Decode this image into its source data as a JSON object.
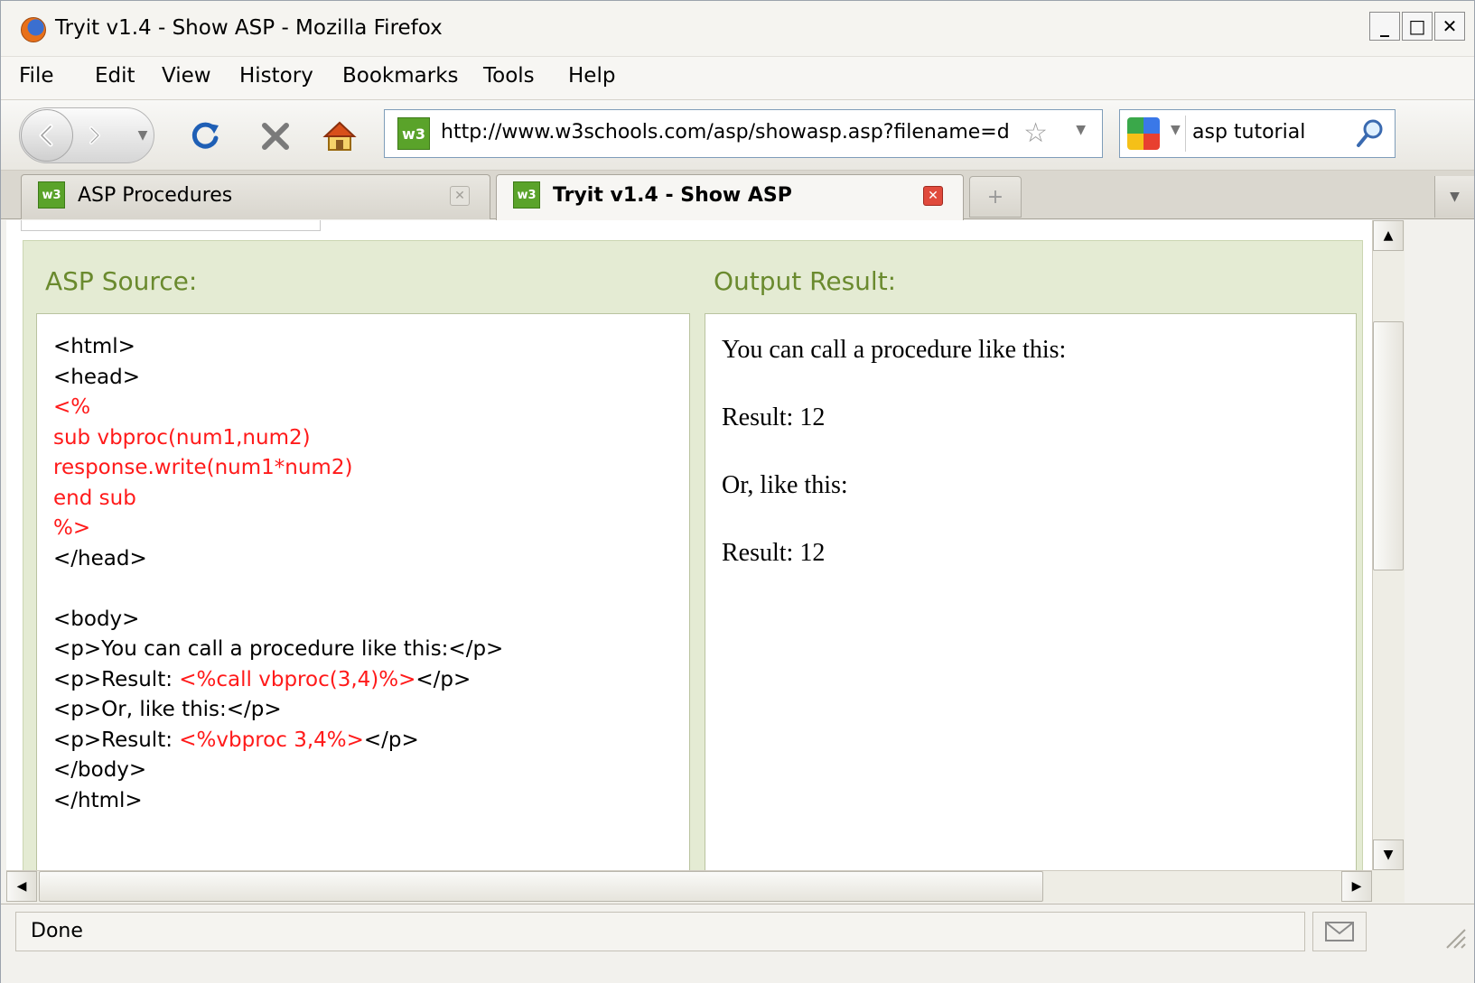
{
  "window": {
    "title": "Tryit v1.4 - Show ASP - Mozilla Firefox",
    "minimize": "_",
    "maximize": "□",
    "close": "✕"
  },
  "menu": {
    "items": [
      {
        "label": "File"
      },
      {
        "label": "Edit"
      },
      {
        "label": "View"
      },
      {
        "label": "History"
      },
      {
        "label": "Bookmarks"
      },
      {
        "label": "Tools"
      },
      {
        "label": "Help"
      }
    ]
  },
  "nav": {
    "url": "http://www.w3schools.com/asp/showasp.asp?filename=d",
    "search_value": "asp tutorial"
  },
  "tabs": [
    {
      "label": "ASP Procedures",
      "active": false
    },
    {
      "label": "Tryit v1.4 - Show ASP",
      "active": true
    }
  ],
  "content": {
    "source_heading": "ASP Source:",
    "output_heading": "Output Result:",
    "code_lines": [
      [
        {
          "t": "<html>",
          "c": "black"
        }
      ],
      [
        {
          "t": "<head>",
          "c": "black"
        }
      ],
      [
        {
          "t": "<%",
          "c": "red"
        }
      ],
      [
        {
          "t": "sub vbproc(num1,num2)",
          "c": "red"
        }
      ],
      [
        {
          "t": "response.write(num1*num2)",
          "c": "red"
        }
      ],
      [
        {
          "t": "end sub",
          "c": "red"
        }
      ],
      [
        {
          "t": "%>",
          "c": "red"
        }
      ],
      [
        {
          "t": "</head>",
          "c": "black"
        }
      ],
      [
        {
          "t": "",
          "c": "black"
        }
      ],
      [
        {
          "t": "<body>",
          "c": "black"
        }
      ],
      [
        {
          "t": "<p>You can call a procedure like this:</p>",
          "c": "black"
        }
      ],
      [
        {
          "t": "<p>Result: ",
          "c": "black"
        },
        {
          "t": "<%call vbproc(3,4)%>",
          "c": "red"
        },
        {
          "t": "</p>",
          "c": "black"
        }
      ],
      [
        {
          "t": "<p>Or, like this:</p>",
          "c": "black"
        }
      ],
      [
        {
          "t": "<p>Result: ",
          "c": "black"
        },
        {
          "t": "<%vbproc 3,4%>",
          "c": "red"
        },
        {
          "t": "</p>",
          "c": "black"
        }
      ],
      [
        {
          "t": "</body>",
          "c": "black"
        }
      ],
      [
        {
          "t": "</html>",
          "c": "black"
        }
      ]
    ],
    "output_paragraphs": [
      "You can call a procedure like this:",
      "Result: 12",
      "Or, like this:",
      "Result: 12"
    ]
  },
  "status": {
    "text": "Done"
  },
  "colors": {
    "code_red": "#ff1a1a",
    "heading_green": "#6a8a2e",
    "panel_bg": "#e4ebd3"
  }
}
